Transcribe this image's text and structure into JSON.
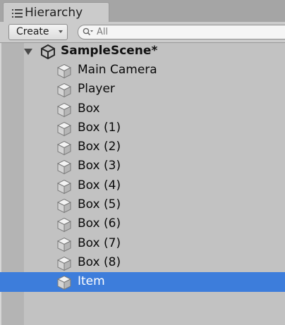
{
  "panel": {
    "tab_label": "Hierarchy",
    "tab_icon": "list-icon"
  },
  "toolbar": {
    "create_label": "Create",
    "create_icon": "chevron-down-icon",
    "search_placeholder": "All",
    "search_icon": "search-icon"
  },
  "scene": {
    "name": "SampleScene*",
    "icon": "unity-logo-icon",
    "expanded": true
  },
  "items": [
    {
      "label": "Main Camera",
      "icon": "cube-icon",
      "selected": false
    },
    {
      "label": "Player",
      "icon": "cube-icon",
      "selected": false
    },
    {
      "label": "Box",
      "icon": "cube-icon",
      "selected": false
    },
    {
      "label": "Box (1)",
      "icon": "cube-icon",
      "selected": false
    },
    {
      "label": "Box (2)",
      "icon": "cube-icon",
      "selected": false
    },
    {
      "label": "Box (3)",
      "icon": "cube-icon",
      "selected": false
    },
    {
      "label": "Box (4)",
      "icon": "cube-icon",
      "selected": false
    },
    {
      "label": "Box (5)",
      "icon": "cube-icon",
      "selected": false
    },
    {
      "label": "Box (6)",
      "icon": "cube-icon",
      "selected": false
    },
    {
      "label": "Box (7)",
      "icon": "cube-icon",
      "selected": false
    },
    {
      "label": "Box (8)",
      "icon": "cube-icon",
      "selected": false
    },
    {
      "label": "Item",
      "icon": "cube-icon",
      "selected": true
    }
  ],
  "colors": {
    "selection": "#3d7ddb",
    "panel_background": "#c2c2c2"
  }
}
